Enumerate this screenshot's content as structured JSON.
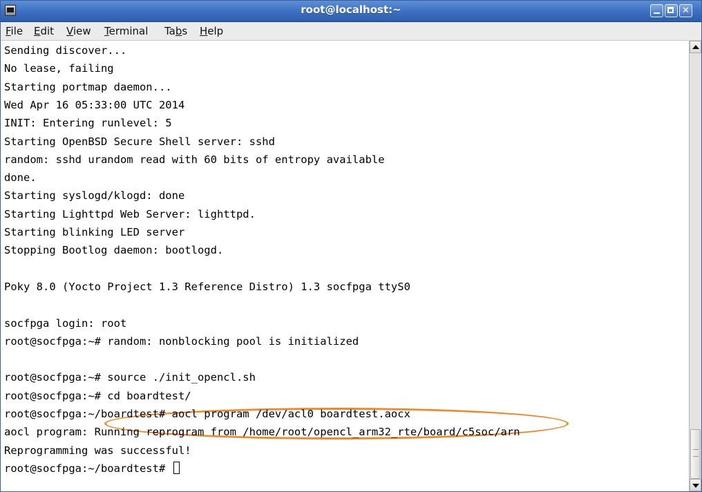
{
  "window": {
    "title": "root@localhost:~",
    "buttons": {
      "minimize": "minimize-icon",
      "maximize": "maximize-icon",
      "close": "close-icon"
    },
    "accent_color": "#3f73c4"
  },
  "menu": {
    "items": [
      {
        "label": "File",
        "mnemonic_index": 0
      },
      {
        "label": "Edit",
        "mnemonic_index": 0
      },
      {
        "label": "View",
        "mnemonic_index": 0
      },
      {
        "label": "Terminal",
        "mnemonic_index": 0
      },
      {
        "label": "Tabs",
        "mnemonic_index": 2
      },
      {
        "label": "Help",
        "mnemonic_index": 0
      }
    ]
  },
  "terminal": {
    "lines": [
      "Sending discover...",
      "No lease, failing",
      "Starting portmap daemon...",
      "Wed Apr 16 05:33:00 UTC 2014",
      "INIT: Entering runlevel: 5",
      "Starting OpenBSD Secure Shell server: sshd",
      "random: sshd urandom read with 60 bits of entropy available",
      "done.",
      "Starting syslogd/klogd: done",
      "Starting Lighttpd Web Server: lighttpd.",
      "Starting blinking LED server",
      "Stopping Bootlog daemon: bootlogd.",
      "",
      "Poky 8.0 (Yocto Project 1.3 Reference Distro) 1.3 socfpga ttyS0",
      "",
      "socfpga login: root",
      "root@socfpga:~# random: nonblocking pool is initialized",
      "",
      "root@socfpga:~# source ./init_opencl.sh",
      "root@socfpga:~# cd boardtest/",
      "root@socfpga:~/boardtest# aocl program /dev/acl0 boardtest.aocx",
      "aocl program: Running reprogram from /home/root/opencl_arm32_rte/board/c5soc/arn",
      "Reprogramming was successful!",
      "root@socfpga:~/boardtest# "
    ],
    "highlight_color": "#ef8a2c"
  }
}
